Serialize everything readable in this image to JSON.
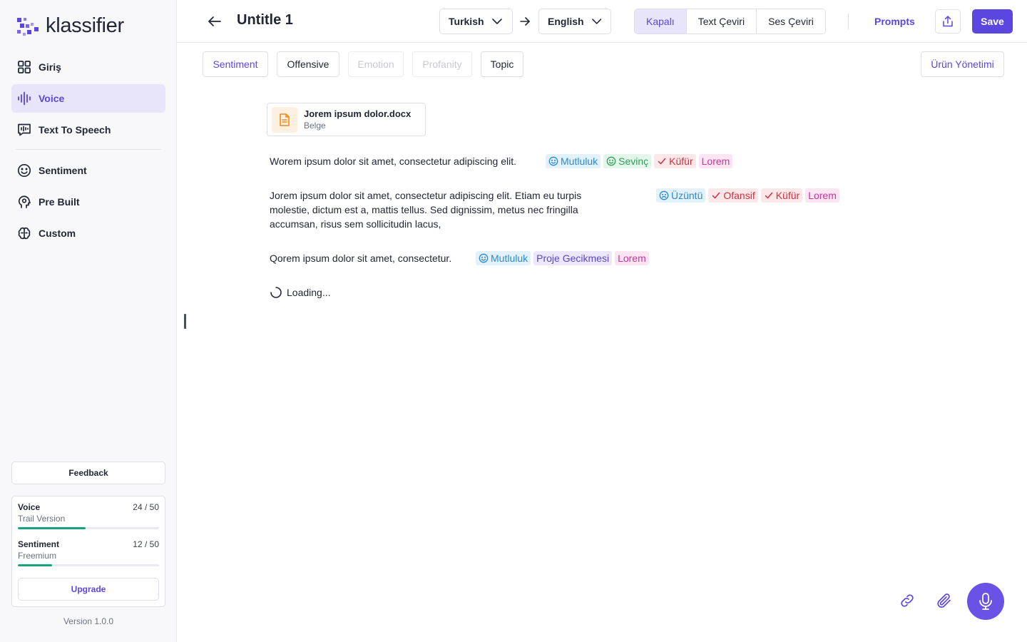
{
  "app": {
    "name": "klassifier",
    "version": "Version 1.0.0"
  },
  "sidebar": {
    "items": [
      {
        "label": "Giriş",
        "icon": "grid-icon"
      },
      {
        "label": "Voice",
        "icon": "waveform-icon",
        "active": true
      },
      {
        "label": "Text To Speech",
        "icon": "speech-bubble-icon"
      },
      {
        "label": "Sentiment",
        "icon": "smiley-icon"
      },
      {
        "label": "Pre Built",
        "icon": "head-icon"
      },
      {
        "label": "Custom",
        "icon": "brain-icon"
      }
    ],
    "feedback": "Feedback",
    "usage": [
      {
        "title": "Voice",
        "plan": "Trail Version",
        "count": "24 / 50",
        "fraction": 0.48
      },
      {
        "title": "Sentiment",
        "plan": "Freemium",
        "count": "12 / 50",
        "fraction": 0.24
      }
    ],
    "upgrade": "Upgrade"
  },
  "header": {
    "title": "Untitle 1",
    "source_language": "Turkish",
    "target_language": "English",
    "modes": [
      "Kapalı",
      "Text Çeviri",
      "Ses Çeviri"
    ],
    "active_mode": "Kapalı",
    "prompts": "Prompts",
    "save": "Save"
  },
  "filters": {
    "chips": [
      "Sentiment",
      "Offensive",
      "Emotion",
      "Profanity",
      "Topic"
    ],
    "product_management": "Ürün Yönetimi"
  },
  "file": {
    "name": "Jorem ipsum dolor.docx",
    "type": "Belge"
  },
  "paragraphs": [
    {
      "text": "Worem ipsum dolor sit amet, consectetur adipiscing elit.",
      "tags": [
        "Mutluluk",
        "Sevinç",
        "Küfür",
        "Lorem"
      ]
    },
    {
      "lines": [
        "Jorem ipsum dolor sit amet, consectetur adipiscing elit. Etiam eu turpis",
        "molestie, dictum est a, mattis tellus. Sed dignissim, metus nec fringilla",
        "accumsan, risus sem sollicitudin lacus,"
      ],
      "tags": [
        "Üzüntü",
        "Ofansif",
        "Küfür",
        "Lorem"
      ]
    },
    {
      "text": "Qorem ipsum dolor sit amet, consectetur.",
      "tags": [
        "Mutluluk",
        "Proje Gecikmesi",
        "Lorem"
      ]
    }
  ],
  "loading": "Loading...",
  "colors": {
    "accent": "#5b46e0",
    "progress": "#16a37f",
    "mic": "#6b52e6"
  }
}
